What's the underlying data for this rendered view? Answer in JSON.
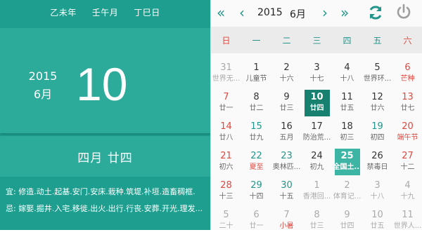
{
  "left": {
    "ganzhi": [
      "乙未年",
      "壬午月",
      "丁巳日"
    ],
    "year": "2015",
    "month": "6月",
    "day": "10",
    "lunar": "四月 廿四",
    "yi": "宜: 修造.动土.起基.安门.安床.栽种.筑堤.补垣.造畜稠框.",
    "ji": "忌: 嫁娶.掘井.入宅.移徙.出火.出行.行丧.安葬.开光.理发..."
  },
  "toolbar": {
    "prev_year": "«",
    "prev_month": "‹",
    "year": "2015",
    "month": "6月",
    "next_month": "›",
    "next_year": "»",
    "refresh_icon": "refresh-icon",
    "power_icon": "power-icon"
  },
  "weekdays": [
    "日",
    "一",
    "二",
    "三",
    "四",
    "五",
    "六"
  ],
  "colors": {
    "primary": "#1d9e8e",
    "accent": "#23958a",
    "weekend": "#e0483f",
    "selected": "#17806f"
  },
  "weeks": [
    [
      {
        "d": "31",
        "l": "世界无..."
      },
      {
        "d": "1",
        "l": "儿童节"
      },
      {
        "d": "2",
        "l": "十六"
      },
      {
        "d": "3",
        "l": "十七"
      },
      {
        "d": "4",
        "l": "十八"
      },
      {
        "d": "5",
        "l": "世界环..."
      },
      {
        "d": "6",
        "l": "芒种"
      }
    ],
    [
      {
        "d": "7",
        "l": "廿一"
      },
      {
        "d": "8",
        "l": "廿二"
      },
      {
        "d": "9",
        "l": "廿三"
      },
      {
        "d": "10",
        "l": "廿四"
      },
      {
        "d": "11",
        "l": "廿五"
      },
      {
        "d": "12",
        "l": "廿六"
      },
      {
        "d": "13",
        "l": "廿七"
      }
    ],
    [
      {
        "d": "14",
        "l": "廿八"
      },
      {
        "d": "15",
        "l": "廿九"
      },
      {
        "d": "16",
        "l": "五月"
      },
      {
        "d": "17",
        "l": "防治荒..."
      },
      {
        "d": "18",
        "l": "初三"
      },
      {
        "d": "19",
        "l": "初四"
      },
      {
        "d": "20",
        "l": "端午节"
      }
    ],
    [
      {
        "d": "21",
        "l": "初六"
      },
      {
        "d": "22",
        "l": "夏至"
      },
      {
        "d": "23",
        "l": "奥林匹..."
      },
      {
        "d": "24",
        "l": "初九"
      },
      {
        "d": "25",
        "l": "全国土..."
      },
      {
        "d": "26",
        "l": "禁毒日"
      },
      {
        "d": "27",
        "l": "十二"
      }
    ],
    [
      {
        "d": "28",
        "l": "十三"
      },
      {
        "d": "29",
        "l": "十四"
      },
      {
        "d": "30",
        "l": "十五"
      },
      {
        "d": "1",
        "l": "香港回..."
      },
      {
        "d": "2",
        "l": "体育记..."
      },
      {
        "d": "3",
        "l": "十八"
      },
      {
        "d": "4",
        "l": "十九"
      }
    ],
    [
      {
        "d": "5",
        "l": "二十"
      },
      {
        "d": "6",
        "l": "廿一"
      },
      {
        "d": "7",
        "l": "小暑"
      },
      {
        "d": "8",
        "l": "廿三"
      },
      {
        "d": "9",
        "l": "廿四"
      },
      {
        "d": "10",
        "l": "廿五"
      },
      {
        "d": "11",
        "l": "世界人..."
      }
    ]
  ]
}
